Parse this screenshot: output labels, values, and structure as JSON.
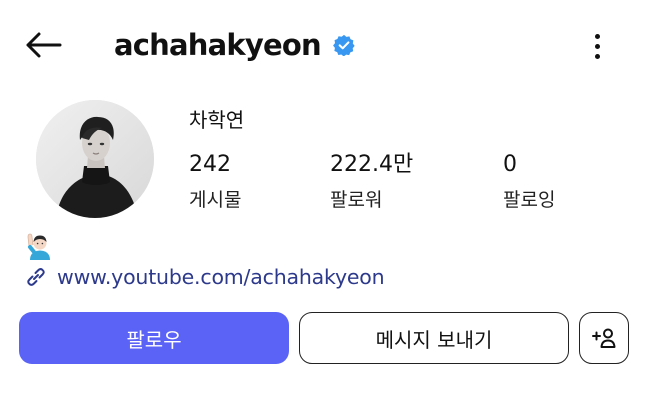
{
  "header": {
    "username": "achahakyeon",
    "verified": true,
    "icons": {
      "back": "back-arrow-icon",
      "verified": "verified-badge-icon",
      "more": "more-options-icon"
    }
  },
  "profile": {
    "full_name": "차학연",
    "avatar": "profile-avatar",
    "stats": [
      {
        "value": "242",
        "label": "게시물"
      },
      {
        "value": "222.4만",
        "label": "팔로워"
      },
      {
        "value": "0",
        "label": "팔로잉"
      }
    ],
    "bio_emoji": "🙋🏻‍♂️",
    "link": {
      "text": "www.youtube.com/achahakyeon",
      "icon": "link-icon"
    }
  },
  "actions": {
    "follow_label": "팔로우",
    "message_label": "메시지 보내기",
    "suggest_icon": "add-person-icon"
  },
  "colors": {
    "primary_button": "#5a63f5",
    "verified": "#3897f0",
    "link": "#2d3a8c"
  }
}
